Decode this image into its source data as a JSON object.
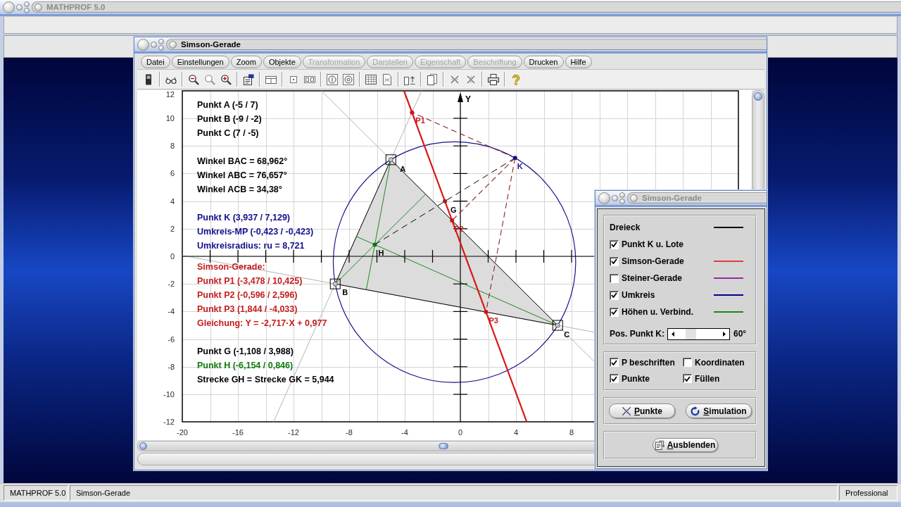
{
  "app": {
    "title": "MATHPROF 5.0",
    "active": false
  },
  "window": {
    "title": "Simson-Gerade",
    "active": true
  },
  "menu": [
    {
      "label": "Datei",
      "disabled": false
    },
    {
      "label": "Einstellungen",
      "disabled": false
    },
    {
      "label": "Zoom",
      "disabled": false
    },
    {
      "label": "Objekte",
      "disabled": false
    },
    {
      "label": "Transformation",
      "disabled": true
    },
    {
      "label": "Darstellen",
      "disabled": true
    },
    {
      "label": "Eigenschaft",
      "disabled": true
    },
    {
      "label": "Beschriftung",
      "disabled": true
    },
    {
      "label": "Drucken",
      "disabled": false
    },
    {
      "label": "Hilfe",
      "disabled": false
    }
  ],
  "plot": {
    "y_ticks": [
      "12",
      "10",
      "8",
      "6",
      "4",
      "2",
      "0",
      "-2",
      "-4",
      "-6",
      "-8",
      "-10",
      "-12"
    ],
    "x_ticks": [
      "-20",
      "-16",
      "-12",
      "-8",
      "-4",
      "0",
      "4",
      "8"
    ],
    "axis_label": "Y",
    "info": [
      {
        "lines": [
          {
            "text": "Punkt A (-5 / 7)",
            "color": "#000000"
          },
          {
            "text": "Punkt B (-9 / -2)",
            "color": "#000000"
          },
          {
            "text": "Punkt C (7 / -5)",
            "color": "#000000"
          }
        ]
      },
      {
        "lines": [
          {
            "text": "Winkel BAC = 68,962°",
            "color": "#000000"
          },
          {
            "text": "Winkel ABC = 76,657°",
            "color": "#000000"
          },
          {
            "text": "Winkel ACB = 34,38°",
            "color": "#000000"
          }
        ]
      },
      {
        "lines": [
          {
            "text": "Punkt K (3,937 / 7,129)",
            "color": "#10108c"
          },
          {
            "text": "Umkreis-MP (-0,423 / -0,423)",
            "color": "#10108c"
          },
          {
            "text": "Umkreisradius: ru = 8,721",
            "color": "#10108c"
          }
        ]
      },
      {
        "lines": [
          {
            "text": "Simson-Gerade:",
            "color": "#c41c1c"
          },
          {
            "text": "Punkt P1 (-3,478 / 10,425)",
            "color": "#c41c1c"
          },
          {
            "text": "Punkt P2 (-0,596 / 2,596)",
            "color": "#c41c1c"
          },
          {
            "text": "Punkt P3 (1,844 / -4,033)",
            "color": "#c41c1c"
          },
          {
            "text": "Gleichung: Y = -2,717·X + 0,977",
            "color": "#c41c1c"
          }
        ]
      },
      {
        "lines": [
          {
            "text": "Punkt G (-1,108 / 3,988)",
            "color": "#000000"
          },
          {
            "text": "Punkt H (-6,154 / 0,846)",
            "color": "#0f7a0f"
          },
          {
            "text": "Strecke GH = Strecke GK = 5,944",
            "color": "#000000"
          }
        ]
      }
    ],
    "points": [
      {
        "label": "A",
        "kind": "vertex",
        "color": "#000000"
      },
      {
        "label": "B",
        "kind": "vertex",
        "color": "#000000"
      },
      {
        "label": "C",
        "kind": "vertex",
        "color": "#000000"
      },
      {
        "label": "K",
        "kind": "point",
        "color": "#12128e"
      },
      {
        "label": "P1",
        "kind": "point",
        "color": "#d01818"
      },
      {
        "label": "P2",
        "kind": "point",
        "color": "#d01818"
      },
      {
        "label": "P3",
        "kind": "point",
        "color": "#d01818"
      },
      {
        "label": "G",
        "kind": "point",
        "color": "#000000"
      },
      {
        "label": "H",
        "kind": "point",
        "color": "#000000"
      }
    ]
  },
  "dialog": {
    "title": "Simson-Gerade",
    "active": false,
    "legend": [
      {
        "kind": "label",
        "label": "Dreieck",
        "color": "#000000"
      },
      {
        "kind": "checkbox",
        "label": "Punkt K u. Lote",
        "checked": true
      },
      {
        "kind": "checkbox",
        "label": "Simson-Gerade",
        "checked": true,
        "color": "#e03c3c"
      },
      {
        "kind": "checkbox",
        "label": "Steiner-Gerade",
        "checked": false,
        "color": "#a028a0"
      },
      {
        "kind": "checkbox",
        "label": "Umkreis",
        "checked": true,
        "color": "#000090"
      },
      {
        "kind": "checkbox",
        "label": "Höhen u. Verbind.",
        "checked": true,
        "color": "#168a16"
      }
    ],
    "slider": {
      "label": "Pos. Punkt K:",
      "level": 0.25,
      "reading": "60°"
    },
    "options": [
      {
        "label": "P beschriften",
        "checked": true
      },
      {
        "label": "Koordinaten",
        "checked": false
      },
      {
        "label": "Punkte",
        "checked": true
      },
      {
        "label": "Füllen",
        "checked": true
      }
    ],
    "buttons": [
      {
        "label": "Punkte"
      },
      {
        "label": "Simulation"
      }
    ],
    "hide_button": {
      "label": "Ausblenden"
    }
  },
  "status_bar": [
    "MATHPROF 5.0",
    "Simson-Gerade",
    "Professional"
  ]
}
